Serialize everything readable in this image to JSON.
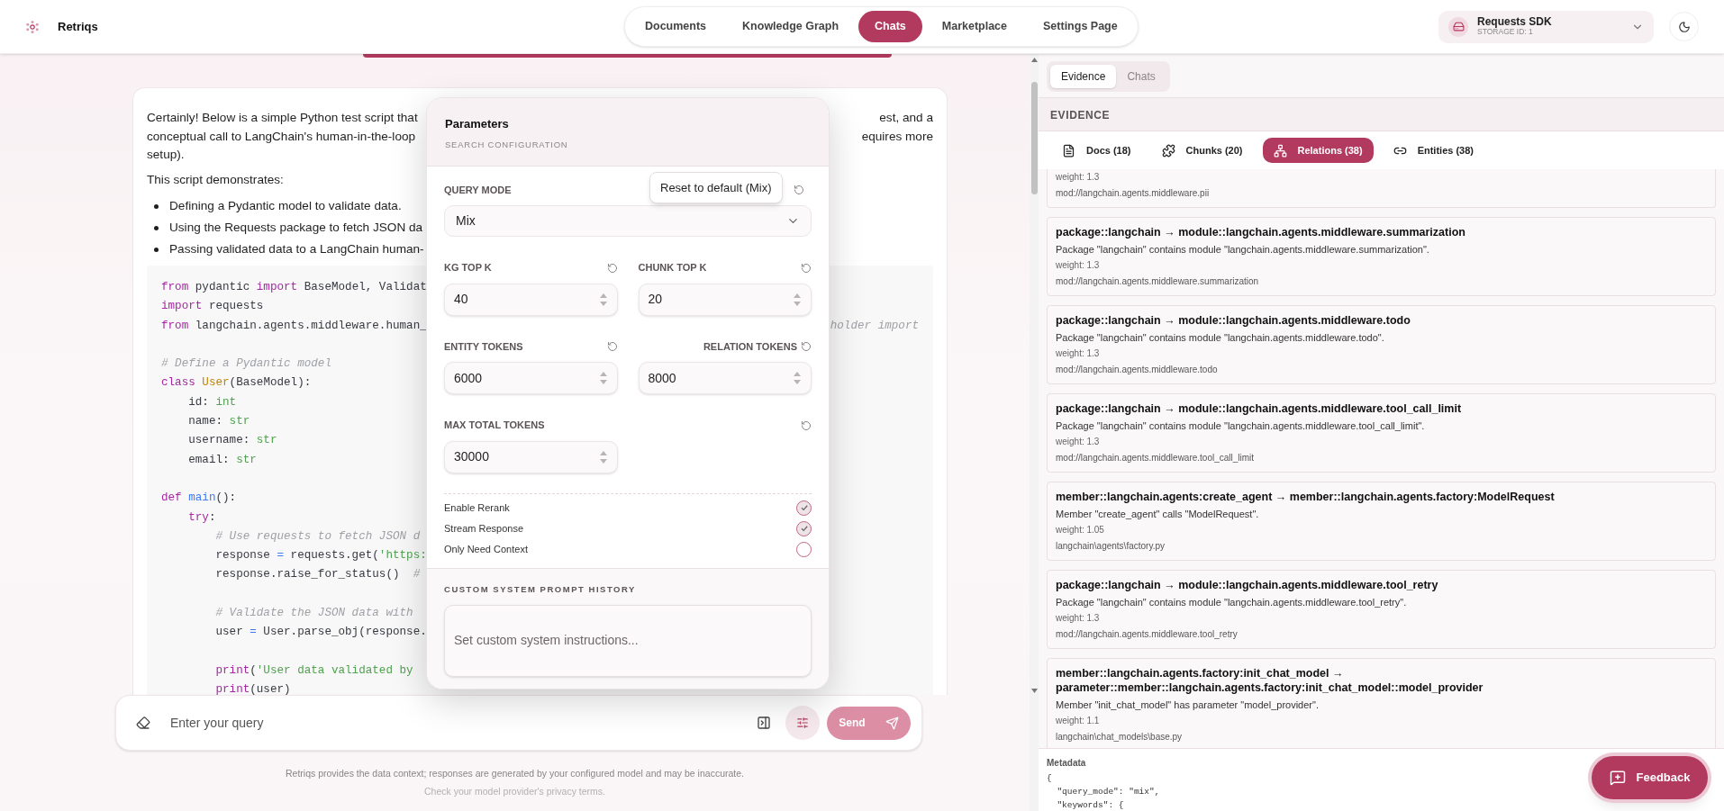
{
  "app": {
    "name": "Retriqs"
  },
  "nav": [
    {
      "label": "Documents",
      "selected": false
    },
    {
      "label": "Knowledge Graph",
      "selected": false
    },
    {
      "label": "Chats",
      "selected": true
    },
    {
      "label": "Marketplace",
      "selected": false
    },
    {
      "label": "Settings Page",
      "selected": false
    }
  ],
  "storage": {
    "name": "Requests SDK",
    "id_label": "STORAGE ID: 1"
  },
  "message": [
    {
      "kind": "paragraph",
      "lines": [
        {
          "left": "Certainly! Below is a simple Python test script that",
          "right": "est, and a"
        },
        {
          "left": "conceptual call to LangChain's human-in-the-loop",
          "right": "equires more"
        },
        {
          "left": "setup)."
        }
      ]
    },
    {
      "kind": "paragraph",
      "lines": [
        {
          "left": "This script demonstrates:"
        }
      ]
    },
    {
      "kind": "bullets",
      "items": [
        "Defining a Pydantic model to validate data.",
        "Using the Requests package to fetch JSON da",
        "Passing validated data to a LangChain human-"
      ]
    },
    {
      "kind": "code",
      "lines": [
        {
          "kind": "code",
          "tokens": [
            {
              "text": "from",
              "kind": "keyword"
            },
            {
              "text": " pydantic ",
              "kind": "plain"
            },
            {
              "text": "import",
              "kind": "keyword"
            },
            {
              "text": " BaseModel, Validat",
              "kind": "plain"
            }
          ]
        },
        {
          "kind": "code",
          "tokens": [
            {
              "text": "import",
              "kind": "keyword"
            },
            {
              "text": " requests",
              "kind": "plain"
            }
          ]
        },
        {
          "kind": "code",
          "tokens": [
            {
              "text": "from",
              "kind": "keyword"
            },
            {
              "text": " langchain.agents.middleware.human_",
              "kind": "plain"
            }
          ],
          "right": "holder import"
        },
        {
          "kind": "blank"
        },
        {
          "kind": "code",
          "tokens": [
            {
              "text": "# Define a Pydantic model",
              "kind": "comment"
            }
          ]
        },
        {
          "kind": "code",
          "tokens": [
            {
              "text": "class",
              "kind": "keyword"
            },
            {
              "text": " User",
              "kind": "type"
            },
            {
              "text": "(BaseModel):",
              "kind": "plain"
            }
          ]
        },
        {
          "kind": "code",
          "tokens": [
            {
              "text": "    id: ",
              "kind": "plain"
            },
            {
              "text": "int",
              "kind": "builtin"
            }
          ]
        },
        {
          "kind": "code",
          "tokens": [
            {
              "text": "    name: ",
              "kind": "plain"
            },
            {
              "text": "str",
              "kind": "builtin"
            }
          ]
        },
        {
          "kind": "code",
          "tokens": [
            {
              "text": "    username: ",
              "kind": "plain"
            },
            {
              "text": "str",
              "kind": "builtin"
            }
          ]
        },
        {
          "kind": "code",
          "tokens": [
            {
              "text": "    email: ",
              "kind": "plain"
            },
            {
              "text": "str",
              "kind": "builtin"
            }
          ]
        },
        {
          "kind": "blank"
        },
        {
          "kind": "code",
          "tokens": [
            {
              "text": "def",
              "kind": "keyword"
            },
            {
              "text": " main",
              "kind": "function"
            },
            {
              "text": "():",
              "kind": "plain"
            }
          ]
        },
        {
          "kind": "code",
          "tokens": [
            {
              "text": "    try",
              "kind": "keyword"
            },
            {
              "text": ":",
              "kind": "plain"
            }
          ]
        },
        {
          "kind": "code",
          "tokens": [
            {
              "text": "        # Use requests to fetch JSON d",
              "kind": "comment"
            }
          ]
        },
        {
          "kind": "code",
          "tokens": [
            {
              "text": "        response ",
              "kind": "plain"
            },
            {
              "text": "=",
              "kind": "function"
            },
            {
              "text": " requests.get(",
              "kind": "plain"
            },
            {
              "text": "'https:",
              "kind": "builtin"
            }
          ]
        },
        {
          "kind": "code",
          "tokens": [
            {
              "text": "        response.raise_for_status()  ",
              "kind": "plain"
            },
            {
              "text": "#",
              "kind": "comment"
            }
          ]
        },
        {
          "kind": "blank"
        },
        {
          "kind": "code",
          "tokens": [
            {
              "text": "        # Validate the JSON data with",
              "kind": "comment"
            }
          ]
        },
        {
          "kind": "code",
          "tokens": [
            {
              "text": "        user ",
              "kind": "plain"
            },
            {
              "text": "=",
              "kind": "function"
            },
            {
              "text": " User.parse_obj(response.",
              "kind": "plain"
            }
          ]
        },
        {
          "kind": "blank"
        },
        {
          "kind": "code",
          "tokens": [
            {
              "text": "        print",
              "kind": "keyword"
            },
            {
              "text": "(",
              "kind": "plain"
            },
            {
              "text": "'User data validated by",
              "kind": "builtin"
            }
          ]
        },
        {
          "kind": "code",
          "tokens": [
            {
              "text": "        print",
              "kind": "keyword"
            },
            {
              "text": "(user)",
              "kind": "plain"
            }
          ]
        }
      ]
    }
  ],
  "input": {
    "placeholder": "Enter your query",
    "send": "Send"
  },
  "footer": [
    "Retriqs provides the data context; responses are generated by your configured model and may be inaccurate.",
    "Check your model provider's privacy terms."
  ],
  "parameters": {
    "title": "Parameters",
    "subtitle": "SEARCH CONFIGURATION",
    "query_mode": {
      "label": "QUERY MODE",
      "value": "Mix",
      "tooltip": "Reset to default (Mix)"
    },
    "fields": [
      {
        "label": "KG TOP K",
        "value": "40",
        "kind": "half",
        "label_right": false
      },
      {
        "label": "CHUNK TOP K",
        "value": "20",
        "kind": "half",
        "label_right": false
      },
      {
        "label": "ENTITY TOKENS",
        "value": "6000",
        "kind": "half",
        "label_right": false
      },
      {
        "label": "RELATION TOKENS",
        "value": "8000",
        "kind": "half",
        "label_right": true
      },
      {
        "label": "MAX TOTAL TOKENS",
        "value": "30000",
        "kind": "full",
        "label_right": false
      }
    ],
    "toggles": [
      {
        "label": "Enable Rerank",
        "checked": true
      },
      {
        "label": "Stream Response",
        "checked": true
      },
      {
        "label": "Only Need Context",
        "checked": false
      }
    ],
    "prompt": {
      "label": "CUSTOM SYSTEM PROMPT HISTORY",
      "placeholder": "Set custom system instructions..."
    }
  },
  "evidence": {
    "tabs": [
      {
        "label": "Evidence",
        "selected": true
      },
      {
        "label": "Chats",
        "selected": false
      }
    ],
    "heading": "EVIDENCE",
    "categories": [
      {
        "label": "Docs (18)",
        "kind": "docs",
        "selected": false
      },
      {
        "label": "Chunks (20)",
        "kind": "chunks",
        "selected": false
      },
      {
        "label": "Relations (38)",
        "kind": "relations",
        "selected": true
      },
      {
        "label": "Entities (38)",
        "kind": "entities",
        "selected": false
      }
    ],
    "relations": [
      {
        "weight": "weight: 1.3",
        "source": "mod://langchain.agents.middleware.pii"
      },
      {
        "title": "package::langchain → module::langchain.agents.middleware.summarization",
        "description": "Package \"langchain\" contains module \"langchain.agents.middleware.summarization\".",
        "weight": "weight: 1.3",
        "source": "mod://langchain.agents.middleware.summarization"
      },
      {
        "title": "package::langchain → module::langchain.agents.middleware.todo",
        "description": "Package \"langchain\" contains module \"langchain.agents.middleware.todo\".",
        "weight": "weight: 1.3",
        "source": "mod://langchain.agents.middleware.todo"
      },
      {
        "title": "package::langchain → module::langchain.agents.middleware.tool_call_limit",
        "description": "Package \"langchain\" contains module \"langchain.agents.middleware.tool_call_limit\".",
        "weight": "weight: 1.3",
        "source": "mod://langchain.agents.middleware.tool_call_limit"
      },
      {
        "title": "member::langchain.agents:create_agent → member::langchain.agents.factory:ModelRequest",
        "description": "Member \"create_agent\" calls \"ModelRequest\".",
        "weight": "weight: 1.05",
        "source": "langchain\\agents\\factory.py"
      },
      {
        "title": "package::langchain → module::langchain.agents.middleware.tool_retry",
        "description": "Package \"langchain\" contains module \"langchain.agents.middleware.tool_retry\".",
        "weight": "weight: 1.3",
        "source": "mod://langchain.agents.middleware.tool_retry"
      },
      {
        "title": "member::langchain.agents.factory:init_chat_model → parameter::member::langchain.agents.factory:init_chat_model::model_provider",
        "description": "Member \"init_chat_model\" has parameter \"model_provider\".",
        "weight": "weight: 1.1",
        "source": "langchain\\chat_models\\base.py"
      }
    ],
    "metadata": {
      "label": "Metadata",
      "lines": [
        "{",
        "  \"query_mode\": \"mix\",",
        "  \"keywords\": {"
      ]
    }
  },
  "feedback": {
    "label": "Feedback"
  }
}
